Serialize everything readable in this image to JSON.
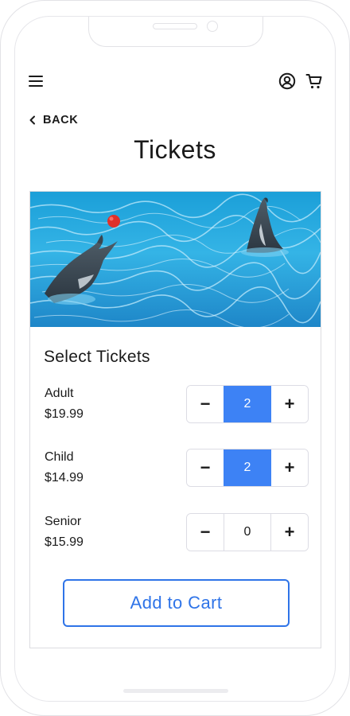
{
  "header": {
    "menu_icon": "hamburger-menu-icon",
    "account_icon": "user-account-icon",
    "cart_icon": "shopping-cart-icon"
  },
  "nav": {
    "back_label": "BACK"
  },
  "page": {
    "title": "Tickets"
  },
  "hero": {
    "image": "dolphins-in-pool-with-red-ball"
  },
  "selector": {
    "title": "Select Tickets",
    "tickets": [
      {
        "name": "Adult",
        "price": "$19.99",
        "quantity": "2",
        "decrement": "−",
        "increment": "+"
      },
      {
        "name": "Child",
        "price": "$14.99",
        "quantity": "2",
        "decrement": "−",
        "increment": "+"
      },
      {
        "name": "Senior",
        "price": "$15.99",
        "quantity": "0",
        "decrement": "−",
        "increment": "+"
      }
    ]
  },
  "actions": {
    "add_to_cart": "Add to Cart"
  },
  "colors": {
    "accent": "#3d82f5",
    "button_border": "#2f74e8",
    "text": "#1a1a1a"
  }
}
